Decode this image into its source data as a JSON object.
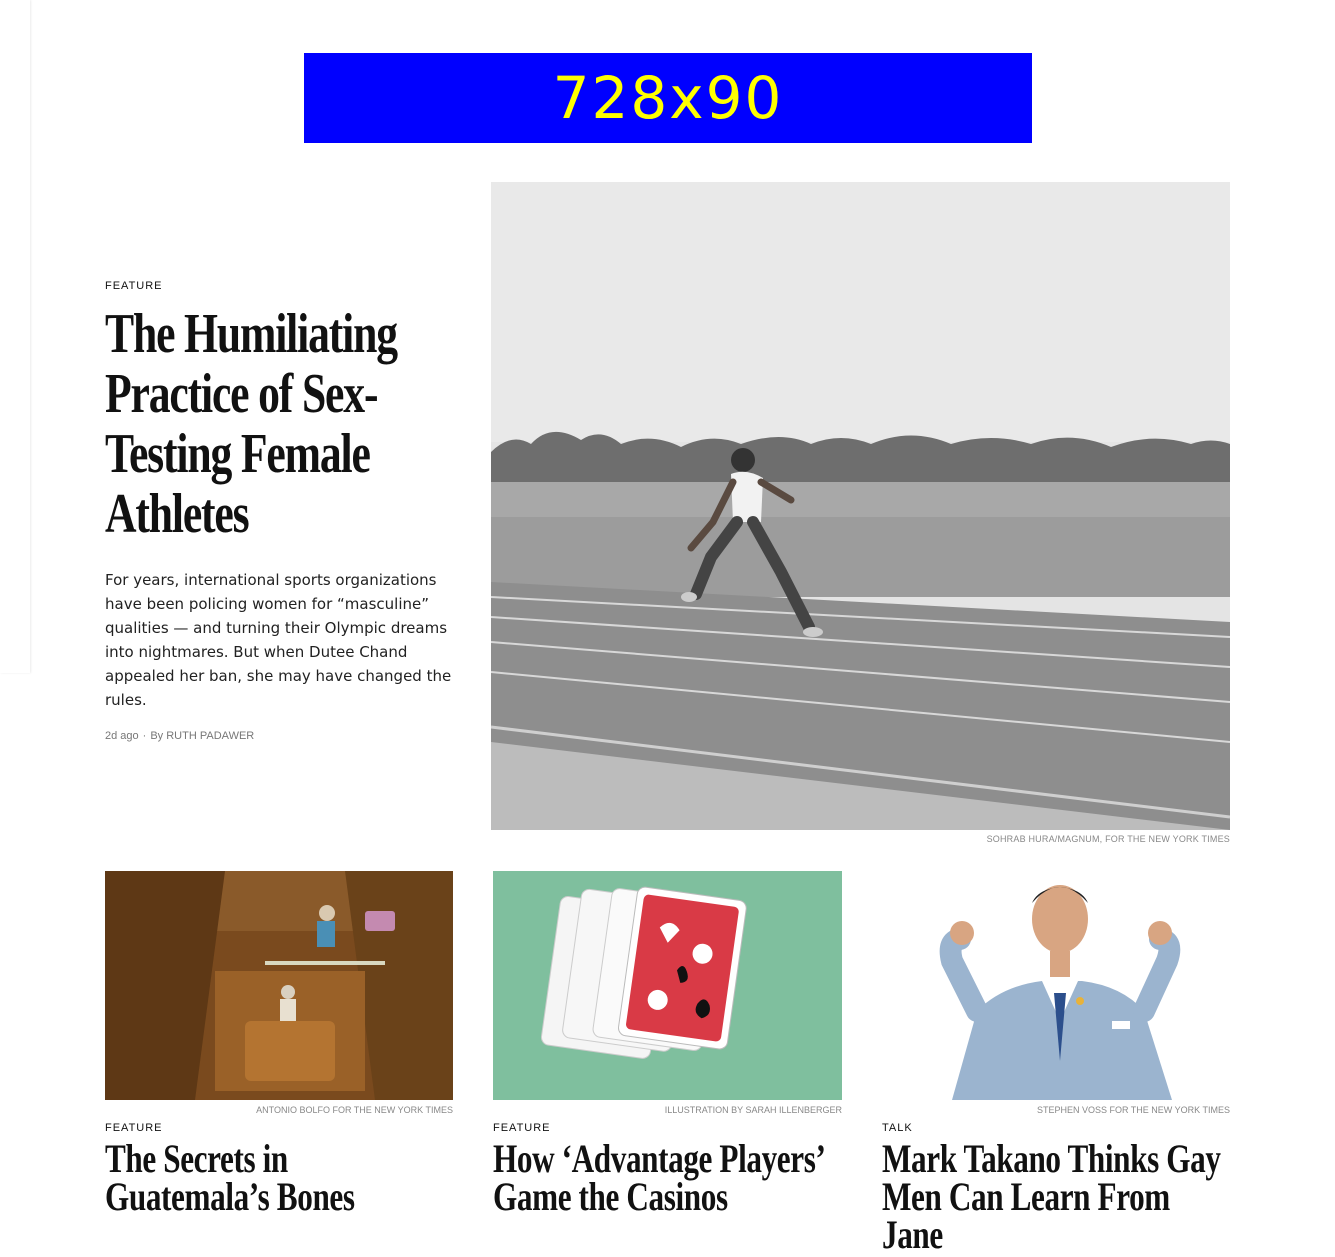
{
  "ad": {
    "label": "728x90"
  },
  "hero": {
    "kicker": "Feature",
    "title": "The Humiliating Practice of Sex-Testing Female Athletes",
    "summary": "For years, international sports organizations have been policing women for “masculine” qualities — and turning their Olympic dreams into nightmares. But when Dutee Chand appealed her ban, she may have changed the rules.",
    "time": "2d ago",
    "by": "By",
    "author": "Ruth Padawer",
    "image_credit": "Sohrab Hura/Magnum, for The New York Times"
  },
  "cards": [
    {
      "credit": "Antonio Bolfo for The New York Times",
      "kicker": "Feature",
      "title": "The Secrets in Guatemala’s Bones"
    },
    {
      "credit": "Illustration by Sarah Illenberger",
      "kicker": "Feature",
      "title": "How ‘Advantage Players’ Game the Casinos"
    },
    {
      "credit": "Stephen Voss for The New York Times",
      "kicker": "Talk",
      "title": "Mark Takano Thinks Gay Men Can Learn From Jane"
    }
  ],
  "colors": {
    "ad_background": "#0000ff",
    "ad_text": "#ffff00",
    "card2_background": "#7fbf9e",
    "card_red": "#d93a46"
  }
}
